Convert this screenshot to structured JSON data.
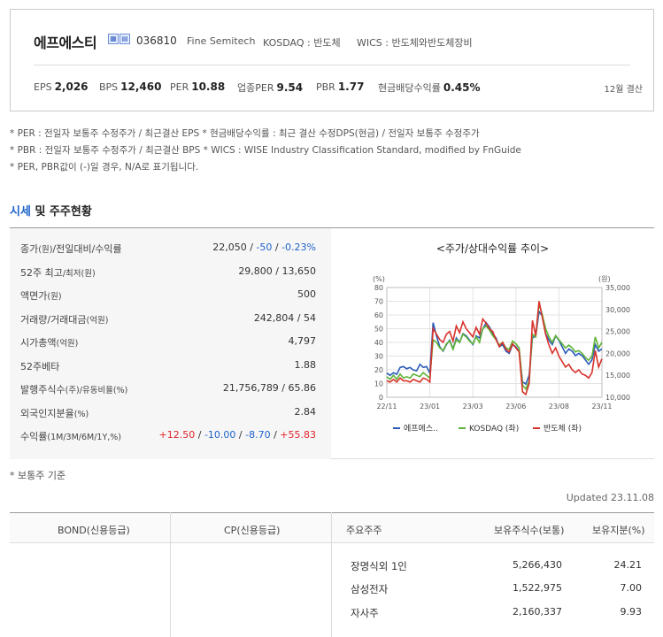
{
  "company": {
    "name": "에프에스티",
    "code": "036810",
    "english_name": "Fine Semitech",
    "market": "KOSDAQ : 반도체",
    "wics": "WICS : 반도체와반도체장비",
    "icons": [
      "building-icon",
      "document-icon"
    ]
  },
  "ratios": [
    {
      "label": "EPS",
      "value": "2,026"
    },
    {
      "label": "BPS",
      "value": "12,460"
    },
    {
      "label": "PER",
      "value": "10.88"
    },
    {
      "label": "업종PER",
      "value": "9.54"
    },
    {
      "label": "PBR",
      "value": "1.77"
    },
    {
      "label": "현금배당수익률",
      "value": "0.45%"
    }
  ],
  "settlement": "12월 결산",
  "notes": [
    "* PER : 전일자 보통주 수정주가 / 최근결산 EPS * 현금배당수익률 : 최근 결산 수정DPS(현금) / 전일자 보통주 수정주가",
    "* PBR : 전일자 보통주 수정주가 / 최근결산 BPS * WICS : WISE Industry Classification Standard, modified by FnGuide",
    "* PER, PBR값이 (-)일 경우, N/A로 표기됩니다."
  ],
  "section": {
    "title_highlight": "시세",
    "title_rest": " 및 주주현황"
  },
  "stats": [
    {
      "label": "종가",
      "label_unit": "(원)",
      "label2": "/전일대비/수익률",
      "value": "22,050 / ",
      "change": "-50",
      "sep": " / ",
      "rate": "-0.23%"
    },
    {
      "label": "52주 최고",
      "label_unit": "",
      "label2": "/최저(원)",
      "value": "29,800 / 13,650"
    },
    {
      "label": "액면가",
      "label_unit": "(원)",
      "label2": "",
      "value": "500"
    },
    {
      "label": "거래량/거래대금",
      "label_unit": "(억원)",
      "label2": "",
      "value": "242,804 / 54"
    },
    {
      "label": "시가총액",
      "label_unit": "(억원)",
      "label2": "",
      "value": "4,797"
    },
    {
      "label": "52주베타",
      "label_unit": "",
      "label2": "",
      "value": "1.88"
    },
    {
      "label": "발행주식수",
      "label_unit": "(주)",
      "label2": "/유동비율(%)",
      "value": "21,756,789 / 65.86"
    },
    {
      "label": "외국인지분율",
      "label_unit": "(%)",
      "label2": "",
      "value": "2.84"
    },
    {
      "label": "수익률",
      "label_unit": "(1M/3M/6M/1Y,%)",
      "label2": "",
      "returns": [
        "+12.50",
        "-10.00",
        "-8.70",
        "+55.83"
      ]
    }
  ],
  "chart_data": {
    "type": "line",
    "title": "<주가/상대수익률 추이>",
    "left_axis_unit": "(%)",
    "right_axis_unit": "(원)",
    "ylim_left": [
      0,
      80
    ],
    "ylim_right": [
      10000,
      35000
    ],
    "left_ticks": [
      "80",
      "70",
      "60",
      "50",
      "40",
      "30",
      "20",
      "10",
      "0"
    ],
    "right_ticks": [
      "35,000",
      "30,000",
      "25,000",
      "20,000",
      "15,000",
      "10,000"
    ],
    "x_ticks": [
      "22/11",
      "23/01",
      "23/03",
      "23/06",
      "23/08",
      "23/11"
    ],
    "grid": true,
    "legend_position": "bottom",
    "series": [
      {
        "name": "에프에스..",
        "axis": "right",
        "color": "#2b5cb8",
        "values": [
          15500,
          15000,
          15600,
          15200,
          16800,
          17000,
          16500,
          16800,
          16200,
          16000,
          17500,
          16800,
          17000,
          15500,
          27000,
          24000,
          21500,
          20500,
          22000,
          23000,
          21000,
          23500,
          22500,
          24500,
          24000,
          23000,
          22000,
          24000,
          23500,
          25500,
          27000,
          26000,
          24500,
          23500,
          21500,
          22000,
          20500,
          20000,
          22000,
          21500,
          20500,
          13500,
          13000,
          15000,
          23500,
          24000,
          29500,
          28500,
          24500,
          23000,
          22000,
          24000,
          23000,
          21500,
          20000,
          21000,
          20500,
          19500,
          20000,
          19500,
          18500,
          17500,
          18500,
          22000,
          20500,
          21000
        ]
      },
      {
        "name": "KOSDAQ (좌)",
        "axis": "left",
        "color": "#5fb335",
        "values": [
          15,
          13,
          16,
          13,
          17,
          14,
          15,
          14,
          17,
          16,
          15,
          18,
          16,
          14,
          42,
          40,
          36,
          34,
          39,
          41,
          35,
          42,
          40,
          46,
          44,
          41,
          39,
          44,
          40,
          50,
          52,
          49,
          45,
          42,
          38,
          40,
          36,
          35,
          41,
          39,
          36,
          9,
          6,
          12,
          46,
          44,
          68,
          60,
          50,
          44,
          40,
          45,
          42,
          39,
          36,
          38,
          36,
          33,
          34,
          32,
          29,
          27,
          30,
          44,
          36,
          40
        ]
      },
      {
        "name": "반도체 (좌)",
        "axis": "left",
        "color": "#d8322c",
        "values": [
          12,
          11,
          13,
          11,
          14,
          12,
          12,
          11,
          13,
          12,
          11,
          14,
          13,
          11,
          50,
          46,
          42,
          40,
          46,
          48,
          41,
          52,
          47,
          55,
          50,
          47,
          44,
          51,
          46,
          57,
          54,
          50,
          48,
          42,
          37,
          40,
          35,
          33,
          39,
          36,
          33,
          4,
          2,
          10,
          56,
          45,
          70,
          58,
          46,
          38,
          32,
          36,
          30,
          26,
          22,
          24,
          20,
          18,
          20,
          17,
          16,
          14,
          18,
          34,
          22,
          28
        ]
      }
    ]
  },
  "stock_note": "* 보통주 기준",
  "updated": "Updated 23.11.08",
  "bottom": {
    "bond_header": "BOND(신용등급)",
    "cp_header": "CP(신용등급)",
    "holder_header": "주요주주",
    "shares_header": "보유주식수(보통)",
    "pct_header": "보유지분(%)",
    "holders": [
      {
        "name": "장명식외 1인",
        "shares": "5,266,430",
        "pct": "24.21"
      },
      {
        "name": "삼성전자",
        "shares": "1,522,975",
        "pct": "7.00"
      },
      {
        "name": "자사주",
        "shares": "2,160,337",
        "pct": "9.93"
      }
    ]
  }
}
